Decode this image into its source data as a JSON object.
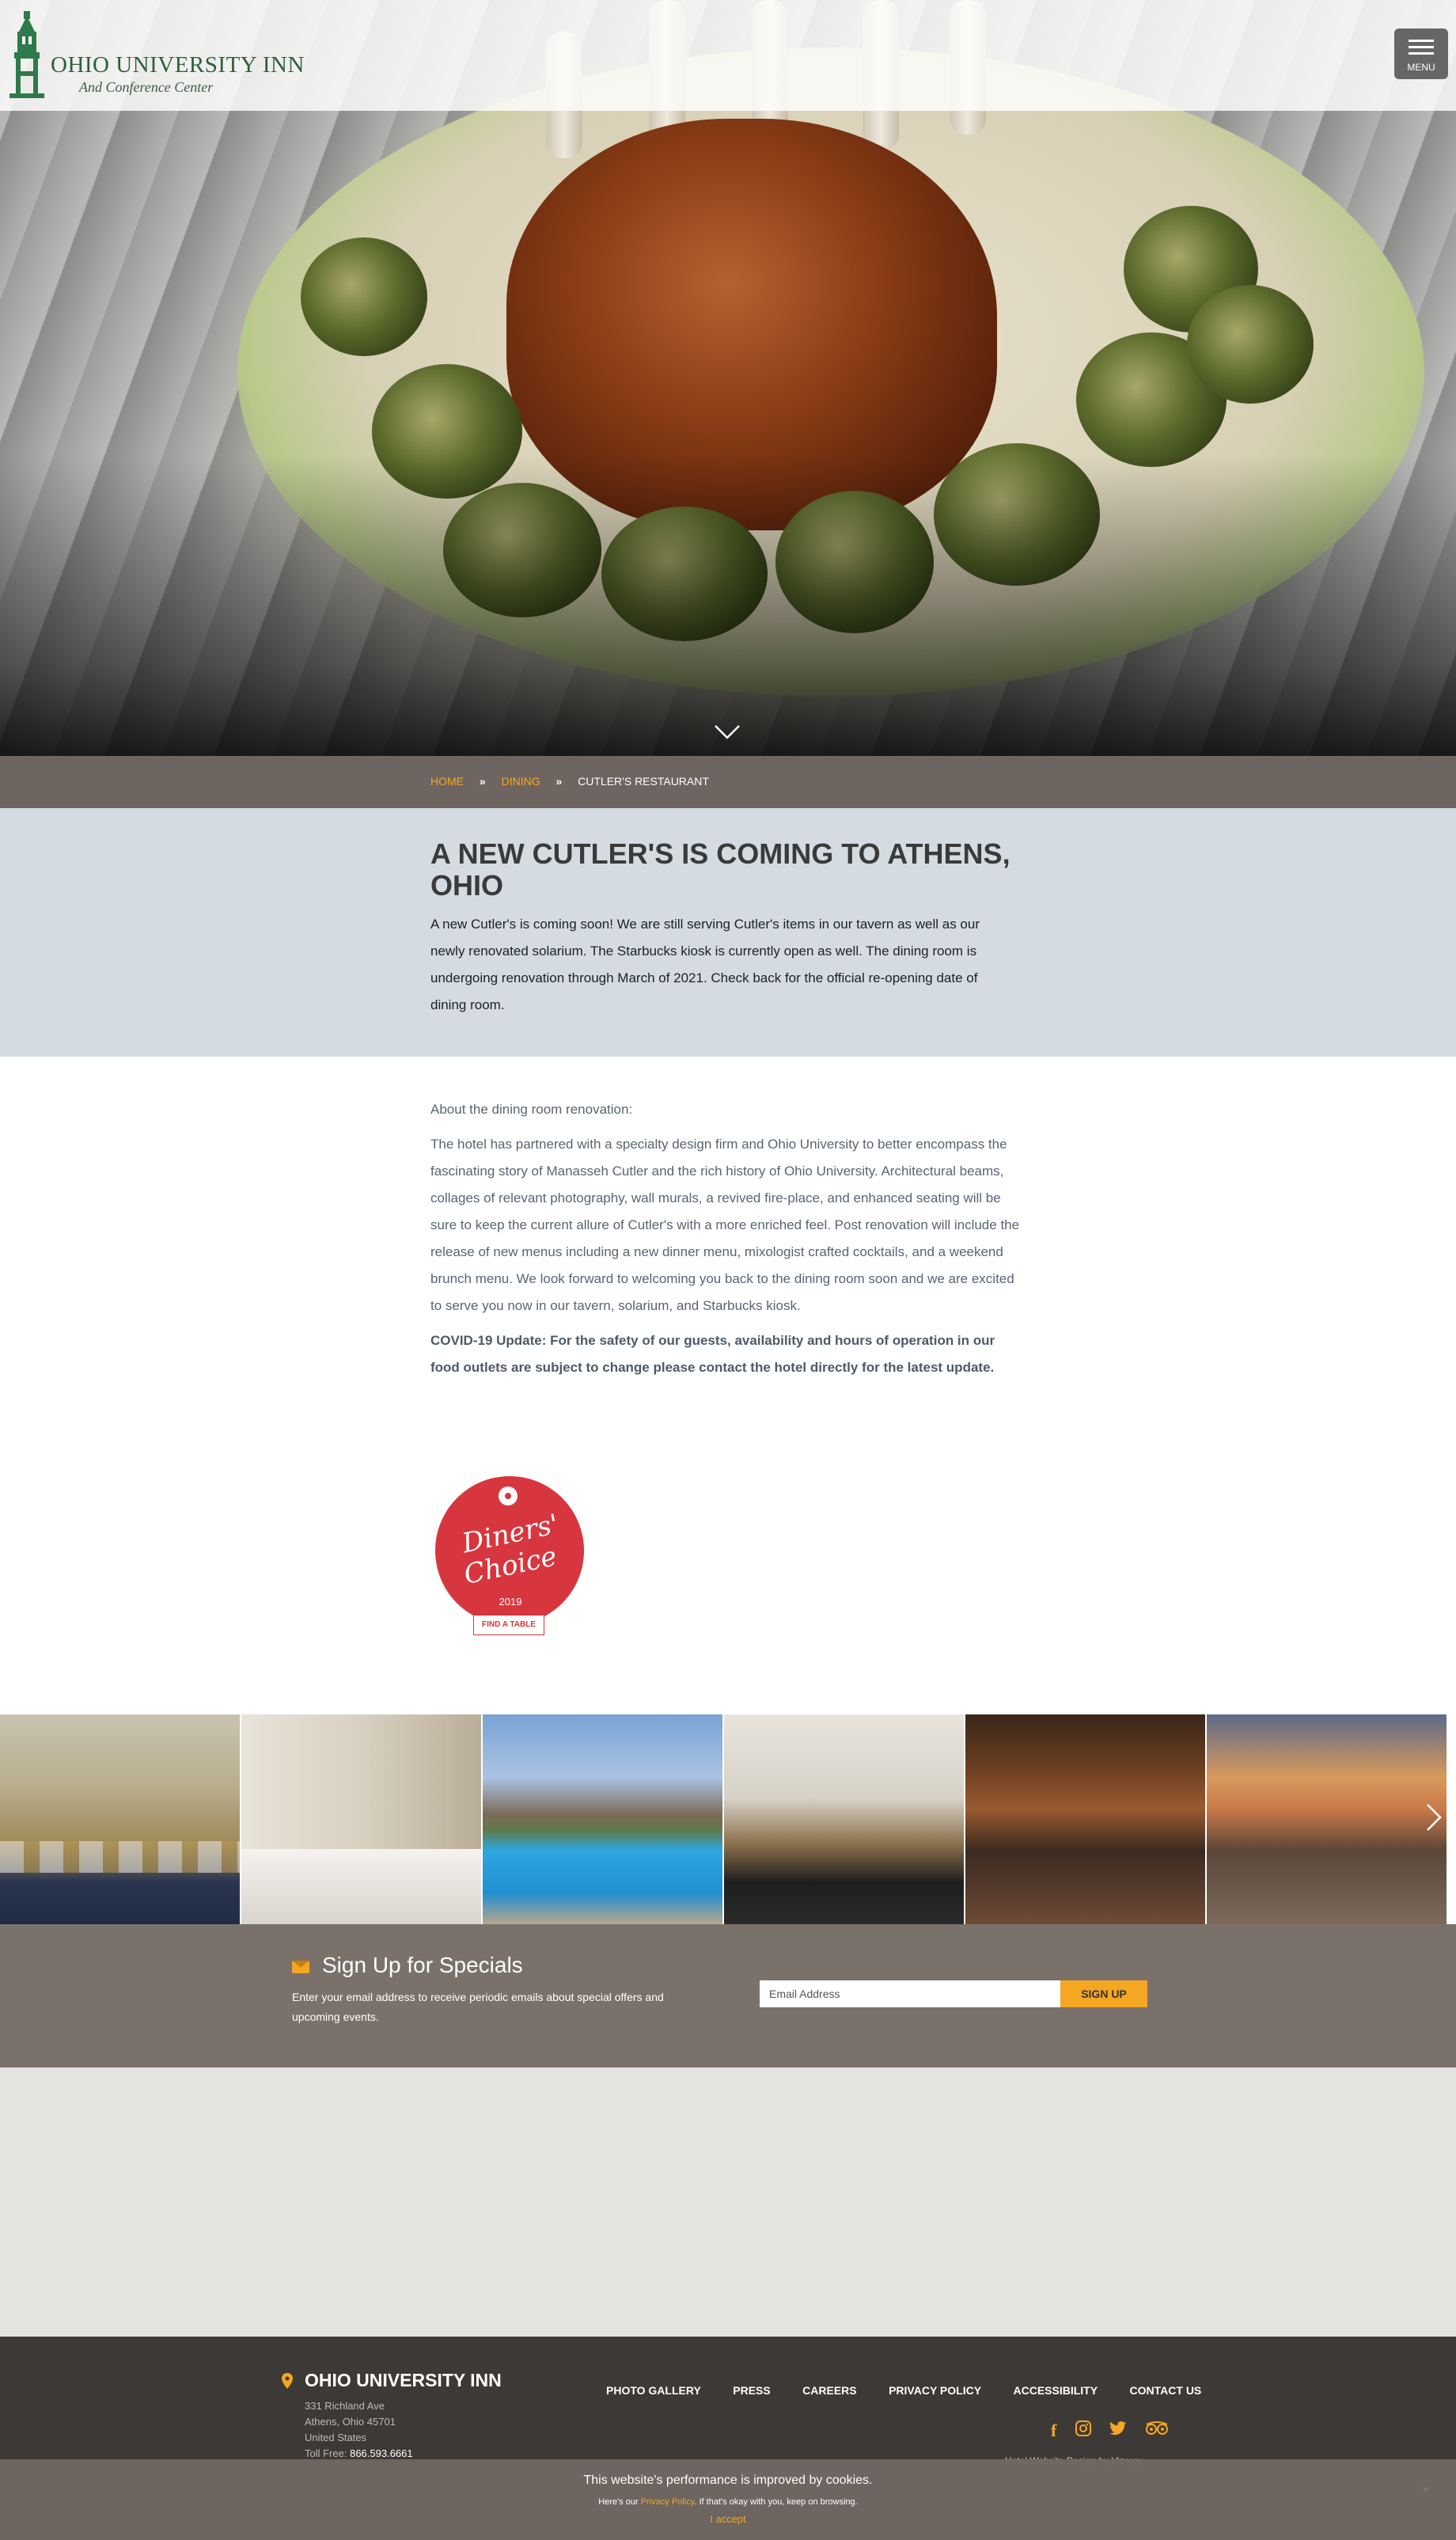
{
  "header": {
    "logo_name": "OHIO UNIVERSITY INN",
    "logo_sub": "And Conference Center",
    "menu_label": "MENU"
  },
  "breadcrumb": {
    "home": "HOME",
    "dining": "DINING",
    "separator": "»",
    "current": "CUTLER'S RESTAURANT"
  },
  "announcement": {
    "title": "A NEW CUTLER'S IS COMING TO ATHENS, OHIO",
    "body": "A new Cutler's is coming soon! We are still serving Cutler's items in our tavern as well as our newly renovated solarium. The Starbucks kiosk is currently open as well. The dining room is undergoing renovation through March of 2021. Check back for the official re-opening date of dining room."
  },
  "content": {
    "heading": "About the dining room renovation:",
    "body": "The hotel has partnered with a specialty design firm and Ohio University to better encompass the fascinating story of Manasseh Cutler and the rich history of Ohio University. Architectural beams, collages of relevant photography, wall murals, a revived fire-place, and enhanced seating will be sure to keep the current allure of Cutler's with a more enriched feel.  Post renovation will include the release of new menus including a new dinner menu, mixologist crafted cocktails, and a weekend brunch menu. We look forward to welcoming you back to the dining room soon and we are excited to serve you now in our tavern, solarium, and Starbucks kiosk.",
    "covid": "COVID-19 Update: For the safety of our guests, availability and hours of operation in our food outlets are subject to change please contact the hotel directly for the latest update."
  },
  "badge": {
    "line1": "Diners'",
    "line2": "Choice",
    "year": "2019",
    "cta": "FIND A TABLE"
  },
  "gallery": {
    "images": [
      "banquet-hall",
      "guest-room",
      "outdoor-pool",
      "boardroom",
      "tavern-bar",
      "patio-fireplace"
    ]
  },
  "signup": {
    "title": "Sign Up for Specials",
    "text": "Enter your email address to receive periodic emails about special offers and upcoming events.",
    "placeholder": "Email Address",
    "button": "SIGN UP"
  },
  "footer": {
    "name": "OHIO UNIVERSITY INN",
    "street": "331 Richland Ave",
    "city": "Athens, Ohio 45701",
    "country": "United States",
    "tollfree_label": "Toll Free:",
    "phone": "866.593.6661",
    "nav": [
      "PHOTO GALLERY",
      "PRESS",
      "CAREERS",
      "PRIVACY POLICY",
      "ACCESSIBILITY",
      "CONTACT US"
    ],
    "social_icons": [
      "facebook-icon",
      "instagram-icon",
      "twitter-icon",
      "tripadvisor-icon"
    ],
    "credit": "Hotel Website Design by Vizergy"
  },
  "cookie": {
    "message": "This website's performance is improved by cookies.",
    "sub_before": "Here's our",
    "policy_link": "Privacy Policy",
    "sub_after": ". If that's okay with you, keep on browsing.",
    "accept": "I accept",
    "close": "×"
  },
  "colors": {
    "accent": "#f5a623",
    "breadcrumb_bg": "#6e6560",
    "announce_bg": "#d4dbe1",
    "signup_bg": "#7b716b",
    "footer_bg": "#3d3936",
    "logo_green": "#2f5f3a"
  }
}
